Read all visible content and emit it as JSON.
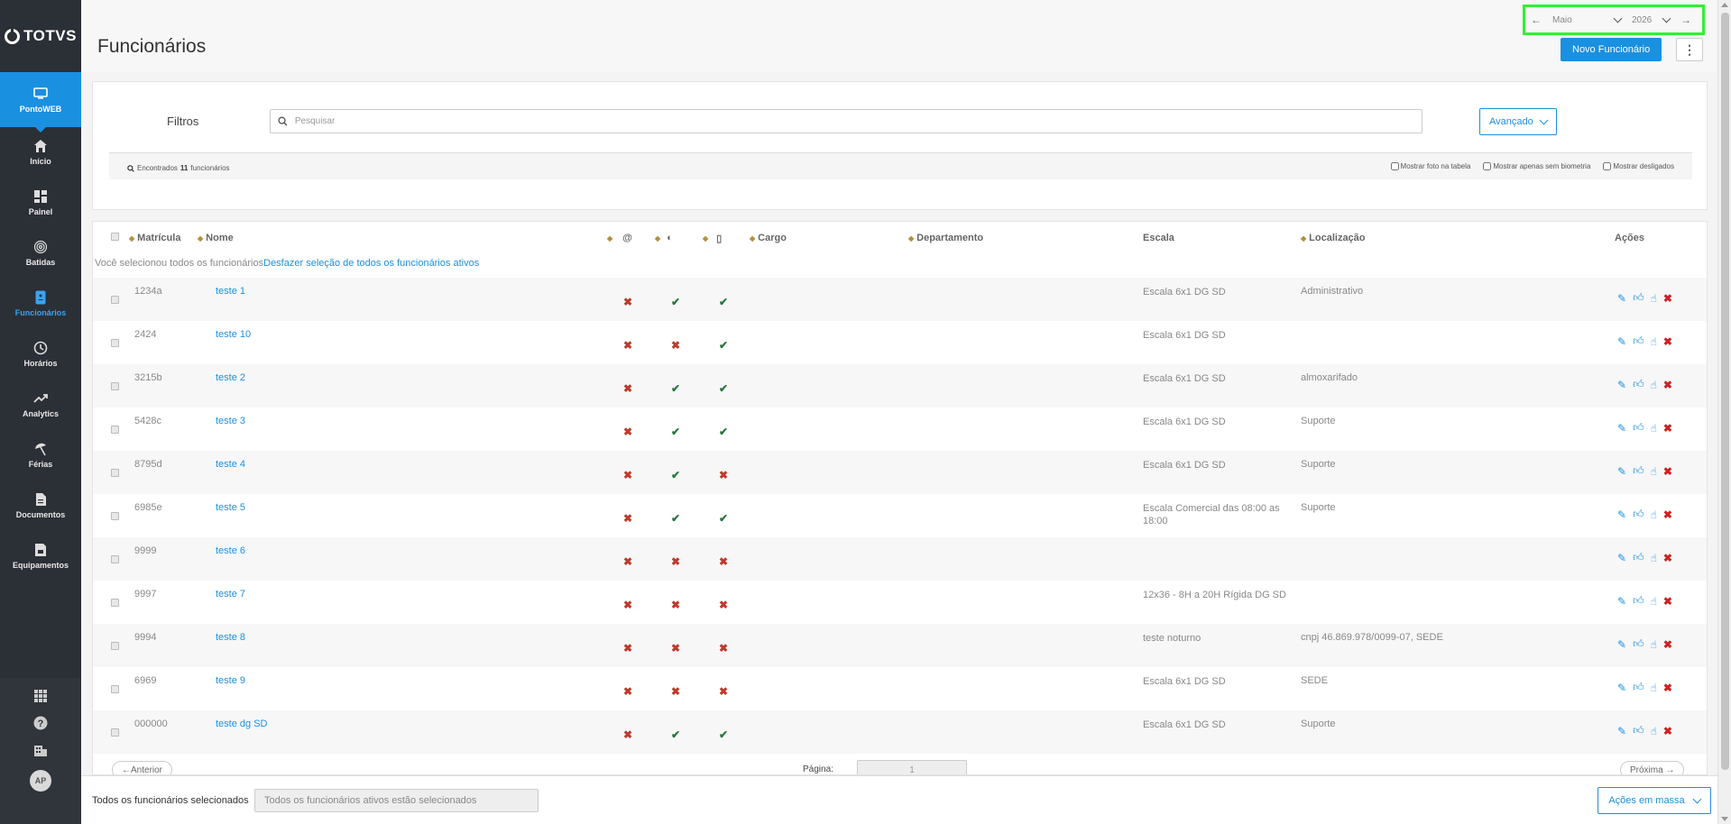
{
  "brand": {
    "logo_text": "TOTVS"
  },
  "sidebar": {
    "items": [
      {
        "label": "PontoWEB",
        "icon": "monitor-icon"
      },
      {
        "label": "Início",
        "icon": "home-icon"
      },
      {
        "label": "Painel",
        "icon": "dashboard-icon"
      },
      {
        "label": "Batidas",
        "icon": "fingerprint-icon"
      },
      {
        "label": "Funcionários",
        "icon": "employee-badge-icon"
      },
      {
        "label": "Horários",
        "icon": "clock-icon"
      },
      {
        "label": "Analytics",
        "icon": "trend-icon"
      },
      {
        "label": "Férias",
        "icon": "beach-umbrella-icon"
      },
      {
        "label": "Documentos",
        "icon": "document-icon"
      },
      {
        "label": "Equipamentos",
        "icon": "device-icon"
      }
    ],
    "bottom": {
      "avatar_initials": "AP"
    }
  },
  "header": {
    "title": "Funcionários",
    "month": "Maio",
    "year": "2026",
    "new_button": "Novo Funcionário"
  },
  "filters": {
    "label": "Filtros",
    "search_placeholder": "Pesquisar",
    "advanced_button": "Avançado",
    "found_prefix": "Encontrados",
    "found_count": "11",
    "found_suffix": "funcionários",
    "check_photo": "Mostrar foto na tabela",
    "check_biometry": "Mostrar apenas sem biometria",
    "check_dismissed": "Mostrar desligados"
  },
  "table": {
    "columns": {
      "matricula": "Matrícula",
      "nome": "Nome",
      "cargo": "Cargo",
      "departamento": "Departamento",
      "escala": "Escala",
      "localizacao": "Localização",
      "acoes": "Ações"
    },
    "selection_notice": "Você selecionou todos os funcionários",
    "selection_undo": "Desfazer seleção de todos os funcionários ativos",
    "rows": [
      {
        "matricula": "1234a",
        "nome": "teste 1",
        "c1": false,
        "c2": true,
        "c3": true,
        "escala": "Escala 6x1 DG SD",
        "localizacao": "Administrativo"
      },
      {
        "matricula": "2424",
        "nome": "teste 10",
        "c1": false,
        "c2": false,
        "c3": true,
        "escala": "Escala 6x1 DG SD",
        "localizacao": ""
      },
      {
        "matricula": "3215b",
        "nome": "teste 2",
        "c1": false,
        "c2": true,
        "c3": true,
        "escala": "Escala 6x1 DG SD",
        "localizacao": "almoxarifado"
      },
      {
        "matricula": "5428c",
        "nome": "teste 3",
        "c1": false,
        "c2": true,
        "c3": true,
        "escala": "Escala 6x1 DG SD",
        "localizacao": "Suporte"
      },
      {
        "matricula": "8795d",
        "nome": "teste 4",
        "c1": false,
        "c2": true,
        "c3": false,
        "escala": "Escala 6x1 DG SD",
        "localizacao": "Suporte"
      },
      {
        "matricula": "6985e",
        "nome": "teste 5",
        "c1": false,
        "c2": true,
        "c3": true,
        "escala": "Escala Comercial das 08:00 as 18:00",
        "localizacao": "Suporte"
      },
      {
        "matricula": "9999",
        "nome": "teste 6",
        "c1": false,
        "c2": false,
        "c3": false,
        "escala": "",
        "localizacao": ""
      },
      {
        "matricula": "9997",
        "nome": "teste 7",
        "c1": false,
        "c2": false,
        "c3": false,
        "escala": "12x36 - 8H a 20H Rígida DG SD",
        "localizacao": ""
      },
      {
        "matricula": "9994",
        "nome": "teste 8",
        "c1": false,
        "c2": false,
        "c3": false,
        "escala": "teste noturno",
        "localizacao": "cnpj 46.869.978/0099-07, SEDE"
      },
      {
        "matricula": "6969",
        "nome": "teste 9",
        "c1": false,
        "c2": false,
        "c3": false,
        "escala": "Escala 6x1 DG SD",
        "localizacao": "SEDE"
      },
      {
        "matricula": "000000",
        "nome": "teste dg SD",
        "c1": false,
        "c2": true,
        "c3": true,
        "escala": "Escala 6x1 DG SD",
        "localizacao": "Suporte"
      }
    ]
  },
  "pagination": {
    "prev": "←Anterior",
    "page_label": "Página:",
    "page_value": "1",
    "next": "Próxima →"
  },
  "footer": {
    "label": "Todos os funcionários selecionados",
    "input_placeholder": "Todos os funcionários ativos estão selecionados",
    "mass_actions": "Ações em massa"
  }
}
